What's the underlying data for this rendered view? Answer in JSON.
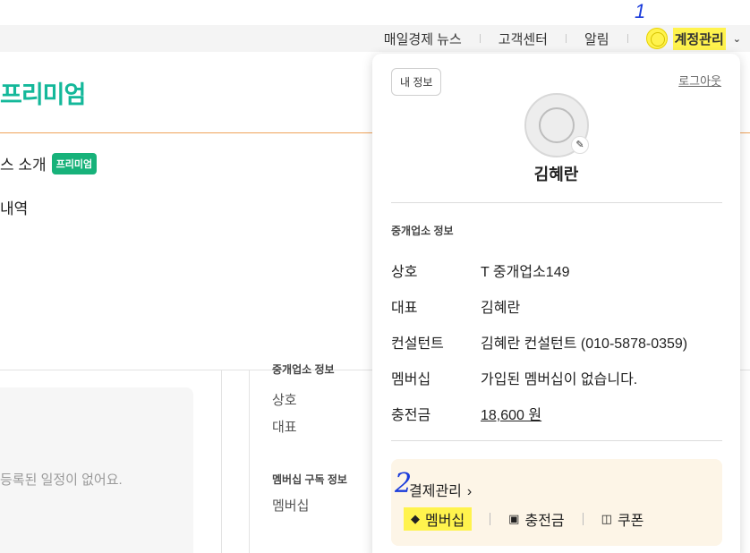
{
  "topnav": {
    "news": "매일경제 뉴스",
    "support": "고객센터",
    "alerts": "알림",
    "account": "계정관리"
  },
  "brand": "프리미엄",
  "page": {
    "intro": "스 소개",
    "premium_tag": "프리미엄",
    "history": "내역",
    "schedule_empty": "등록된 일정이 없어요."
  },
  "background": {
    "section": "중개업소 정보",
    "name_label": "상호",
    "rep_label": "대표",
    "sub_section": "멤버십 구독 정보",
    "membership_label": "멤버십"
  },
  "dropdown": {
    "my_info": "내 정보",
    "logout": "로그아웃",
    "user_name": "김혜란",
    "section_title": "중개업소 정보",
    "rows": [
      {
        "label": "상호",
        "value": "T 중개업소149"
      },
      {
        "label": "대표",
        "value": "김혜란"
      },
      {
        "label": "컨설턴트",
        "value": "김혜란 컨설턴트 (010-5878-0359)"
      },
      {
        "label": "멤버십",
        "value": "가입된 멤버십이 없습니다."
      },
      {
        "label": "충전금",
        "value": "18,600 원"
      }
    ],
    "payment": {
      "title": "결제관리",
      "items": [
        {
          "label": "멤버십"
        },
        {
          "label": "충전금"
        },
        {
          "label": "쿠폰"
        }
      ]
    }
  },
  "annotations": {
    "mark1": "1",
    "mark2": "2"
  },
  "colors": {
    "brand": "#14b89a",
    "highlight": "#fff34d",
    "accent_line": "#f0a35a"
  }
}
